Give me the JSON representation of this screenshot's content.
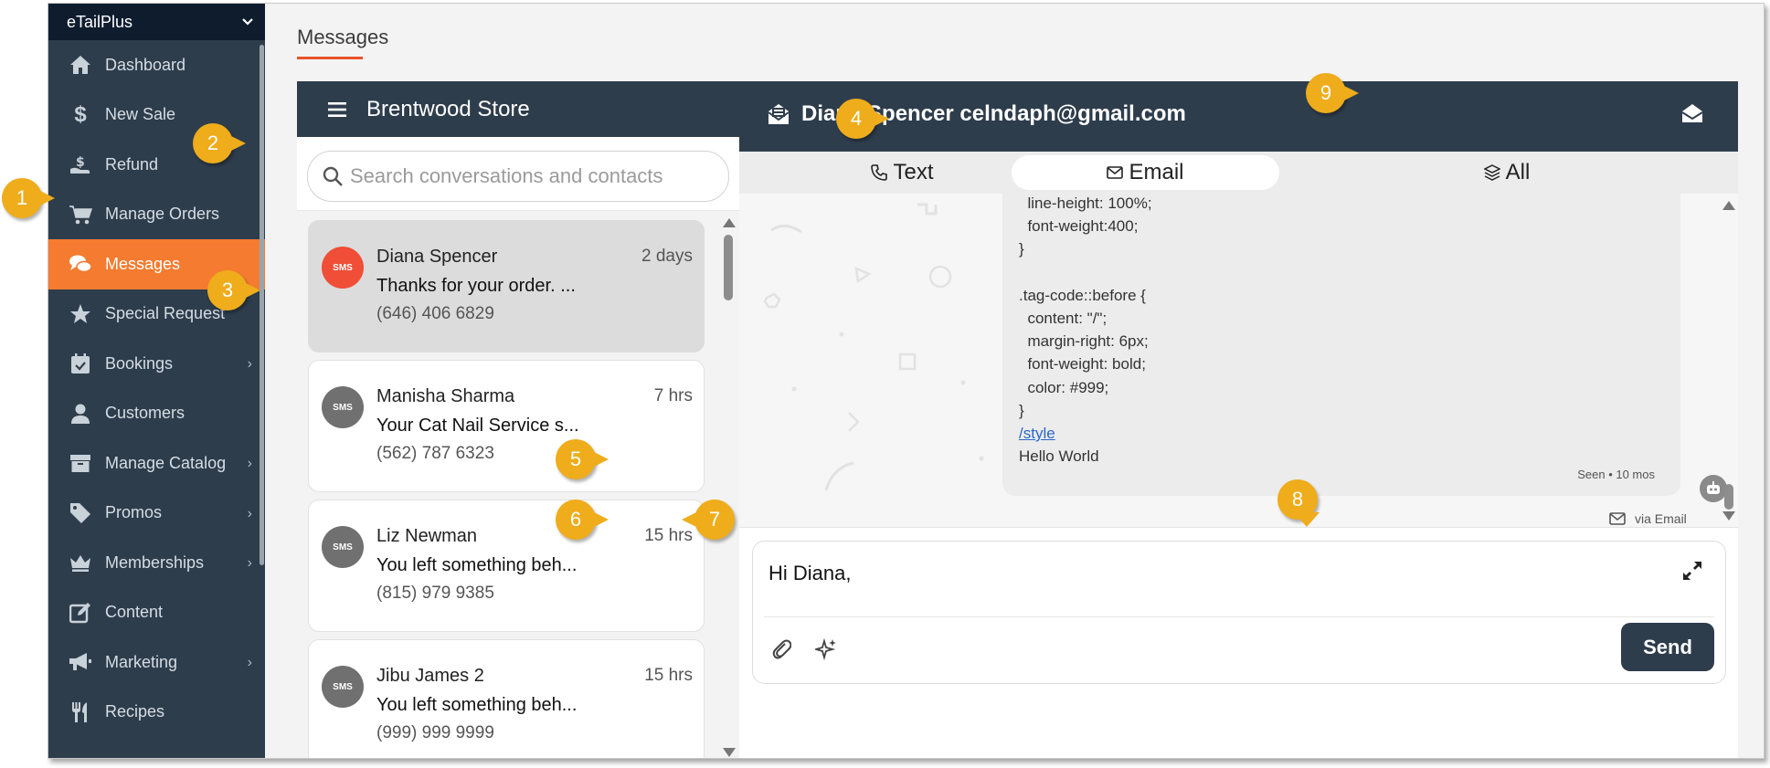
{
  "sidebar": {
    "brand": "eTailPlus",
    "items": [
      {
        "label": "Dashboard",
        "icon": "home-icon"
      },
      {
        "label": "New Sale",
        "icon": "dollar-icon"
      },
      {
        "label": "Refund",
        "icon": "refund-icon"
      },
      {
        "label": "Manage Orders",
        "icon": "cart-icon"
      },
      {
        "label": "Messages",
        "icon": "chat-icon",
        "active": true
      },
      {
        "label": "Special Request",
        "icon": "star-icon"
      },
      {
        "label": "Bookings",
        "icon": "calendar-icon",
        "has_submenu": true
      },
      {
        "label": "Customers",
        "icon": "user-icon"
      },
      {
        "label": "Manage Catalog",
        "icon": "box-icon",
        "has_submenu": true
      },
      {
        "label": "Promos",
        "icon": "tag-icon",
        "has_submenu": true
      },
      {
        "label": "Memberships",
        "icon": "crown-icon",
        "has_submenu": true
      },
      {
        "label": "Content",
        "icon": "edit-icon"
      },
      {
        "label": "Marketing",
        "icon": "megaphone-icon",
        "has_submenu": true
      },
      {
        "label": "Recipes",
        "icon": "utensils-icon"
      }
    ]
  },
  "page": {
    "title": "Messages"
  },
  "store": {
    "name": "Brentwood Store"
  },
  "search": {
    "placeholder": "Search conversations and contacts"
  },
  "conversations": [
    {
      "name": "Diana Spencer",
      "time": "2 days",
      "preview": "Thanks for your order. ...",
      "phone": "(646) 406 6829",
      "badge": "SMS",
      "selected": true
    },
    {
      "name": "Manisha Sharma",
      "time": "7 hrs",
      "preview": "Your Cat Nail Service s...",
      "phone": "(562) 787 6323",
      "badge": "SMS"
    },
    {
      "name": "Liz Newman",
      "time": "15 hrs",
      "preview": "You left something beh...",
      "phone": "(815) 979 9385",
      "badge": "SMS"
    },
    {
      "name": "Jibu James 2",
      "time": "15 hrs",
      "preview": "You left something beh...",
      "phone": "(999) 999 9999",
      "badge": "SMS"
    }
  ],
  "header": {
    "contact": "Diana Spencer celndaph@gmail.com"
  },
  "tabs": [
    {
      "label": "Text",
      "icon": "phone-icon"
    },
    {
      "label": "Email",
      "icon": "envelope-icon",
      "active": true
    },
    {
      "label": "All",
      "icon": "layers-icon"
    }
  ],
  "thread": {
    "code_lines": [
      "  line-height: 100%;",
      "  font-weight:400;",
      "}",
      "",
      ".tag-code::before {",
      "  content: \"/\";",
      "  margin-right: 6px;",
      "  font-weight: bold;",
      "  color: #999;",
      "}"
    ],
    "link_text": "/style",
    "body_text": "Hello World",
    "seen": "Seen  •   10 mos",
    "via": "via Email"
  },
  "composer": {
    "text": "Hi Diana,",
    "send_label": "Send"
  },
  "callouts": [
    "1",
    "2",
    "3",
    "4",
    "5",
    "6",
    "7",
    "8",
    "9"
  ],
  "colors": {
    "sidebar_bg": "#2e3d4c",
    "brand_bg": "#0e1c2e",
    "active": "#f47b2f",
    "accent_line": "#e8532b",
    "callout": "#efac1b",
    "sms_selected": "#f04e37"
  }
}
